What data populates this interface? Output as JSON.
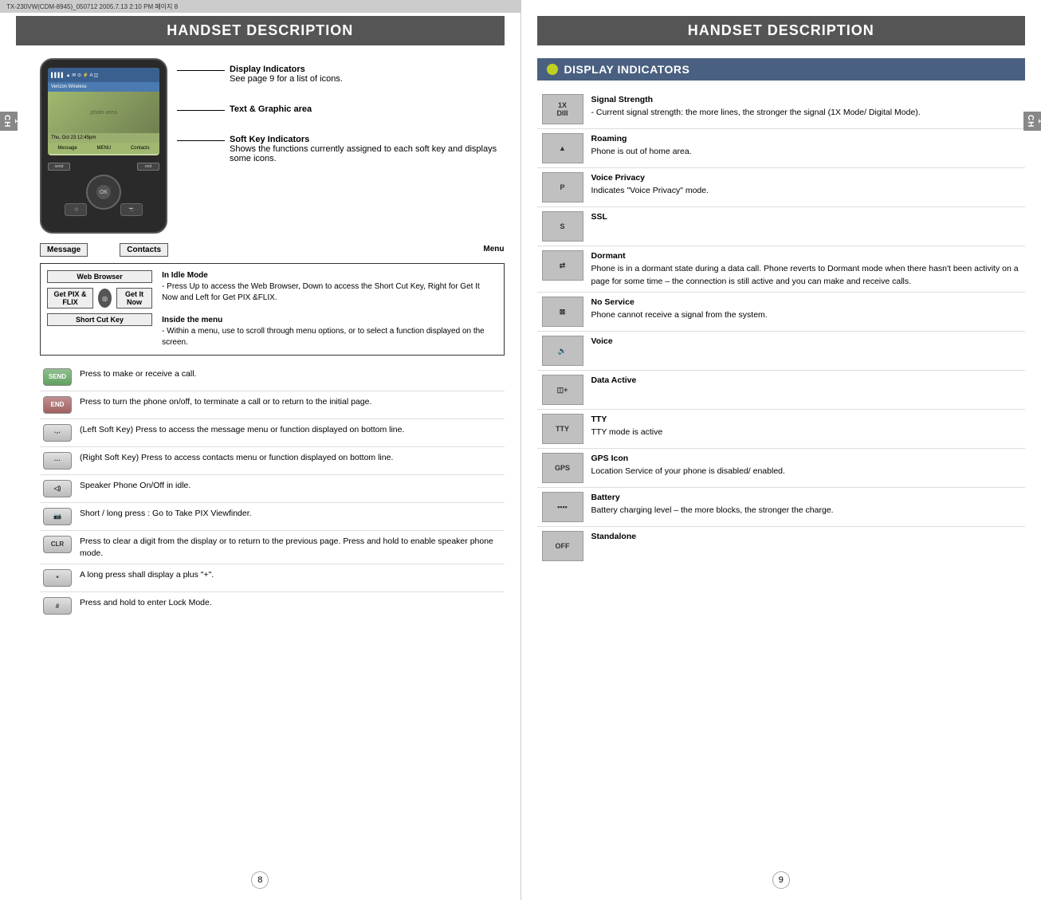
{
  "meta": {
    "top_bar_text": "TX-230VW(CDM-8945)_050712  2005.7.13  2:10 PM  페이지 8",
    "page_left_num": "8",
    "page_right_num": "9"
  },
  "left_page": {
    "header": "HANDSET DESCRIPTION",
    "ch_label": "CH\n1",
    "diagram_labels": {
      "display_indicators_label": "Display Indicators",
      "display_indicators_desc": "See page 9 for a list of icons.",
      "text_graphic_label": "Text & Graphic area",
      "soft_key_label": "Soft Key Indicators",
      "soft_key_desc": "Shows the functions currently assigned to each soft key and displays some icons."
    },
    "softkeys": {
      "message_label": "Message",
      "menu_label": "Menu",
      "contacts_label": "Contacts"
    },
    "idle_mode": {
      "title": "In Idle Mode",
      "web_browser_btn": "Web Browser",
      "get_pix_btn": "Get PIX & FLIX",
      "get_it_now_btn": "Get It Now",
      "short_cut_btn": "Short Cut Key",
      "idle_desc": "- Press Up to access the Web Browser, Down to access the Short Cut Key, Right for Get It Now and Left for Get PIX &FLIX.",
      "inside_menu_title": "Inside the menu",
      "inside_menu_desc": "- Within a menu, use to scroll through menu options, or to select a function displayed on the screen."
    },
    "key_rows": [
      {
        "icon_text": "SEND",
        "icon_type": "send",
        "description": "Press to make or receive a call."
      },
      {
        "icon_text": "END",
        "icon_type": "end",
        "description": "Press to turn the phone on/off, to terminate a call or to return to the initial page."
      },
      {
        "icon_text": "·-·",
        "icon_type": "normal",
        "description": "(Left Soft Key) Press to access the message menu or function displayed on bottom line."
      },
      {
        "icon_text": "···",
        "icon_type": "normal",
        "description": "(Right Soft Key) Press to access contacts menu or function displayed on bottom line."
      },
      {
        "icon_text": "◁)",
        "icon_type": "normal",
        "description": "Speaker Phone On/Off in idle."
      },
      {
        "icon_text": "📷",
        "icon_type": "normal",
        "description": "Short / long press : Go to Take PIX Viewfinder."
      },
      {
        "icon_text": "CLR",
        "icon_type": "normal",
        "description": "Press to clear a digit from the display or to return to the previous page.\nPress and hold to enable speaker phone mode."
      },
      {
        "icon_text": "*",
        "icon_type": "normal",
        "description": "A long press shall display a plus \"+\"."
      },
      {
        "icon_text": "#",
        "icon_type": "normal",
        "description": "Press and hold to enter Lock Mode."
      }
    ]
  },
  "right_page": {
    "header": "HANDSET DESCRIPTION",
    "ch_label": "CH\n1",
    "section_header": "DISPLAY INDICATORS",
    "indicator_rows": [
      {
        "icon_label": "1X\nDIII",
        "title": "Signal Strength",
        "description": "- Current signal strength: the more lines, the stronger the signal (1X Mode/ Digital Mode)."
      },
      {
        "icon_label": "▲",
        "title": "Roaming",
        "description": "Phone is out of home area."
      },
      {
        "icon_label": "P",
        "title": "Voice Privacy",
        "description": "Indicates \"Voice Privacy\" mode."
      },
      {
        "icon_label": "S",
        "title": "SSL",
        "description": ""
      },
      {
        "icon_label": "⇄",
        "title": "Dormant",
        "description": "Phone is in a dormant state during a data call. Phone reverts to Dormant mode when there hasn't been activity on a page for some time – the connection is still active and you can make and receive calls."
      },
      {
        "icon_label": "⊠",
        "title": "No Service",
        "description": "Phone cannot receive a signal from the system."
      },
      {
        "icon_label": "🔊",
        "title": "Voice",
        "description": ""
      },
      {
        "icon_label": "◫+",
        "title": "Data Active",
        "description": ""
      },
      {
        "icon_label": "TTY",
        "title": "TTY",
        "description": "TTY mode is active"
      },
      {
        "icon_label": "GPS",
        "title": "GPS Icon",
        "description": "Location Service of your phone is disabled/ enabled."
      },
      {
        "icon_label": "▪▪▪▪",
        "title": "Battery",
        "description": "Battery charging level – the more blocks, the stronger the charge."
      },
      {
        "icon_label": "OFF",
        "title": "Standalone",
        "description": ""
      }
    ]
  }
}
